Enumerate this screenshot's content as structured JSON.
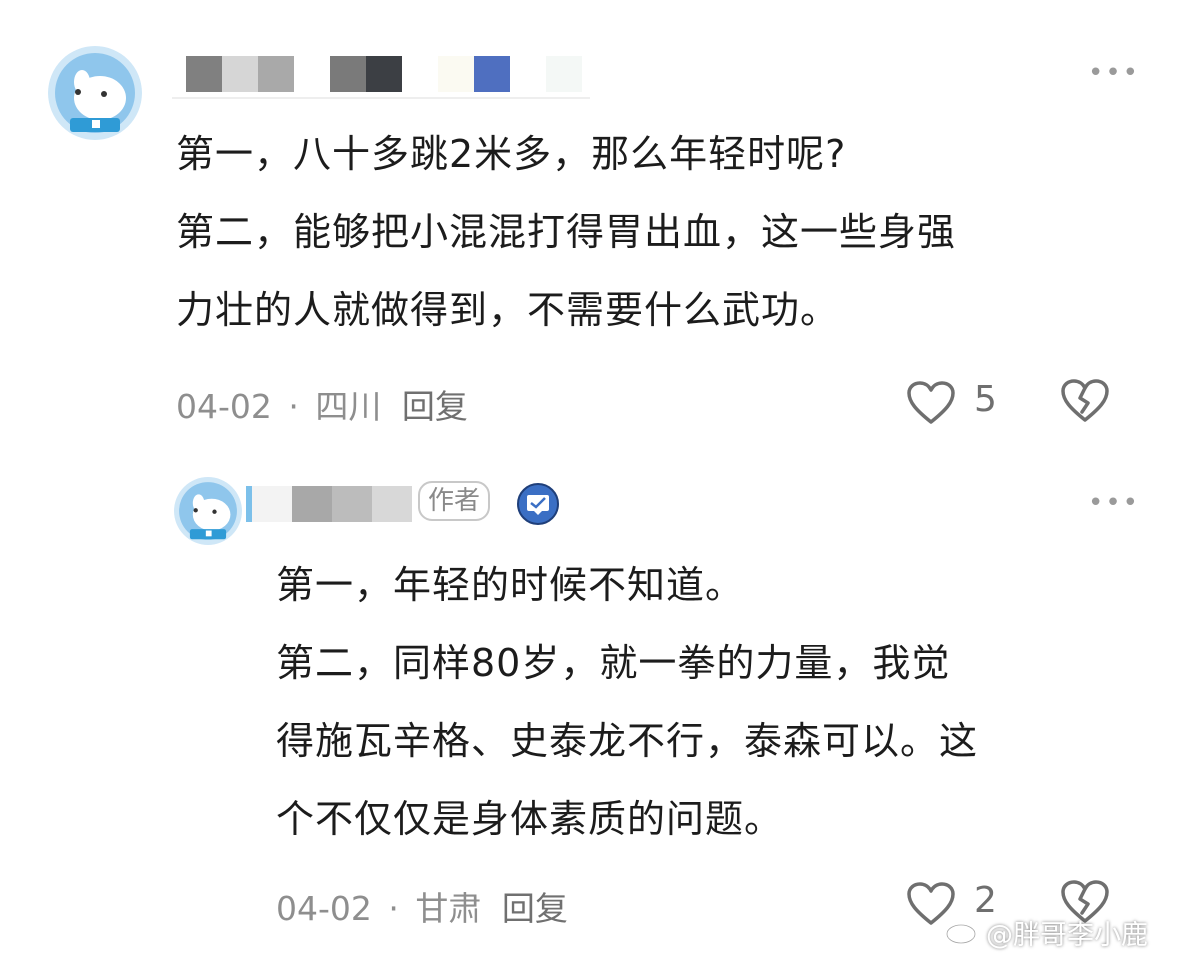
{
  "comment": {
    "lines": [
      "第一，八十多跳2米多，那么年轻时呢?",
      "第二，能够把小混混打得胃出血，这一些身强",
      "力壮的人就做得到，不需要什么武功。"
    ],
    "date": "04-02",
    "separator": "·",
    "location": "四川",
    "reply_label": "回复",
    "likes": "5",
    "more_label": "•••",
    "icons": [
      "avatar-dog",
      "heart-outline-icon",
      "broken-heart-icon",
      "more-icon"
    ]
  },
  "reply": {
    "author_tag": "作者",
    "lines": [
      "第一，年轻的时候不知道。",
      "第二，同样80岁，就一拳的力量，我觉",
      "得施瓦辛格、史泰龙不行，泰森可以。这",
      "个不仅仅是身体素质的问题。"
    ],
    "date": "04-02",
    "separator": "·",
    "location": "甘肃",
    "reply_label": "回复",
    "likes": "2",
    "more_label": "•••",
    "icons": [
      "avatar-dog",
      "verified-badge-icon",
      "heart-outline-icon",
      "broken-heart-icon",
      "more-icon"
    ]
  },
  "watermark": "@胖哥李小鹿",
  "colors": {
    "text": "#1c1c1c",
    "meta": "#8e8e8e",
    "badge_blue": "#3b6fc4",
    "avatar_bg": "#cfe7f7"
  }
}
